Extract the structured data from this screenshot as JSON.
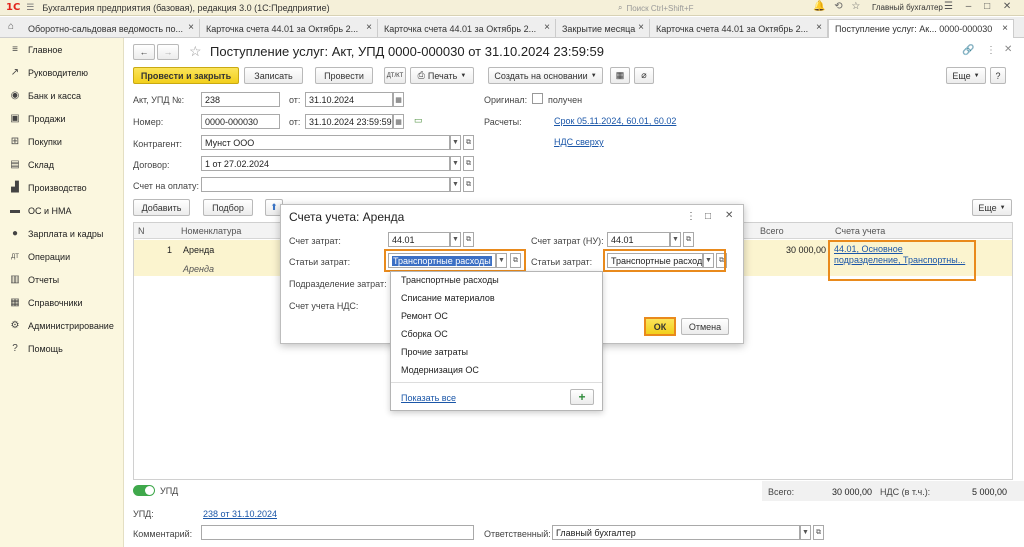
{
  "titlebar": {
    "logo": "1С",
    "app_title": "Бухгалтерия предприятия (базовая), редакция 3.0  (1С:Предприятие)",
    "search_placeholder": "Поиск Ctrl+Shift+F",
    "user": "Главный бухгалтер"
  },
  "tabs": [
    {
      "label": "Оборотно-сальдовая ведомость по..."
    },
    {
      "label": "Карточка счета 44.01 за Октябрь 2..."
    },
    {
      "label": "Карточка счета 44.01 за Октябрь 2..."
    },
    {
      "label": "Закрытие месяца"
    },
    {
      "label": "Карточка счета 44.01 за Октябрь 2..."
    },
    {
      "label": "Поступление услуг: Ак... 0000-000030"
    }
  ],
  "sidebar": {
    "items": [
      {
        "label": "Главное",
        "icon": "menu-icon"
      },
      {
        "label": "Руководителю",
        "icon": "trend-icon"
      },
      {
        "label": "Банк и касса",
        "icon": "coin-icon"
      },
      {
        "label": "Продажи",
        "icon": "bag-icon"
      },
      {
        "label": "Покупки",
        "icon": "cart-icon"
      },
      {
        "label": "Склад",
        "icon": "warehouse-icon"
      },
      {
        "label": "Производство",
        "icon": "factory-icon"
      },
      {
        "label": "ОС и НМА",
        "icon": "truck-icon"
      },
      {
        "label": "Зарплата и кадры",
        "icon": "person-icon"
      },
      {
        "label": "Операции",
        "icon": "dt-kt-icon"
      },
      {
        "label": "Отчеты",
        "icon": "report-icon"
      },
      {
        "label": "Справочники",
        "icon": "book-icon"
      },
      {
        "label": "Администрирование",
        "icon": "gear-icon"
      },
      {
        "label": "Помощь",
        "icon": "help-icon"
      }
    ]
  },
  "doc": {
    "title": "Поступление услуг: Акт, УПД 0000-000030 от 31.10.2024 23:59:59",
    "toolbar": {
      "post_close": "Провести и закрыть",
      "save": "Записать",
      "post": "Провести",
      "print": "Печать",
      "create_based": "Создать на основании",
      "more": "Еще"
    },
    "fields": {
      "act_label": "Акт, УПД №:",
      "act_value": "238",
      "from_label": "от:",
      "act_date": "31.10.2024",
      "number_label": "Номер:",
      "number_value": "0000-000030",
      "number_date": "31.10.2024 23:59:59",
      "original_label": "Оригинал:",
      "original_value": "получен",
      "settlements_label": "Расчеты:",
      "settlements_link": "Срок 05.11.2024, 60.01, 60.02",
      "vat_link": "НДС сверху",
      "counterparty_label": "Контрагент:",
      "counterparty_value": "Мунст ООО",
      "contract_label": "Договор:",
      "contract_value": "1 от 27.02.2024",
      "invoice_label": "Счет на оплату:",
      "invoice_value": ""
    },
    "table_toolbar": {
      "add": "Добавить",
      "select": "Подбор",
      "more": "Еще"
    },
    "table": {
      "headers": {
        "n": "N",
        "nomenclature": "Номенклатура",
        "total": "Всего",
        "account": "Счета учета"
      },
      "rows": [
        {
          "n": "1",
          "name": "Аренда",
          "content": "Аренда",
          "total": "30 000,00",
          "account": "44.01, Основное подразделение, Транспортны..."
        }
      ]
    },
    "footer": {
      "upd_toggle_label": "УПД",
      "upd_label": "УПД:",
      "upd_link": "238 от 31.10.2024",
      "total_label": "Всего:",
      "total_value": "30 000,00",
      "vat_label": "НДС (в т.ч.):",
      "vat_value": "5 000,00",
      "comment_label": "Комментарий:",
      "comment_value": "",
      "responsible_label": "Ответственный:",
      "responsible_value": "Главный бухгалтер"
    }
  },
  "dialog": {
    "title": "Счета учета: Аренда",
    "cost_account_label": "Счет затрат:",
    "cost_account_value": "44.01",
    "cost_account_nu_label": "Счет затрат (НУ):",
    "cost_account_nu_value": "44.01",
    "cost_item_label": "Статьи затрат:",
    "cost_item_value": "Транспортные расходы",
    "cost_item_nu_label": "Статьи затрат:",
    "cost_item_nu_value": "Транспортные расход",
    "division_label": "Подразделение затрат:",
    "vat_account_label": "Счет учета НДС:",
    "ok": "ОК",
    "cancel": "Отмена"
  },
  "dropdown": {
    "items": [
      "Транспортные расходы",
      "Списание материалов",
      "Ремонт ОС",
      "Сборка ОС",
      "Прочие затраты",
      "Модернизация ОС"
    ],
    "show_all": "Показать все",
    "add_symbol": "+"
  },
  "colors": {
    "accent_yellow": "#f2cf1c",
    "highlight_orange": "#e98a1c",
    "sidebar_bg": "#fbf7df",
    "link_blue": "#1a56a8"
  }
}
